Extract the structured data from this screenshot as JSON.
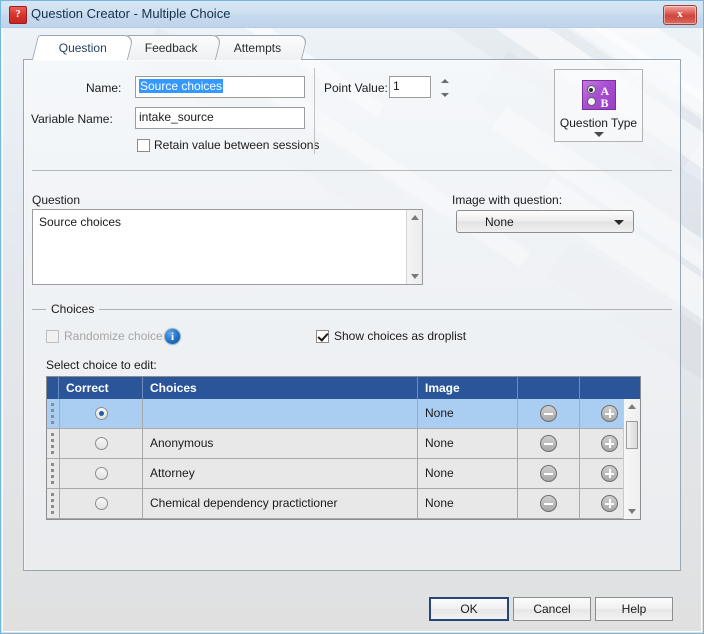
{
  "window": {
    "title": "Question Creator - Multiple Choice",
    "title_icon": "question-mark-icon",
    "close_label": "x"
  },
  "tabs": [
    {
      "label": "Question",
      "active": true
    },
    {
      "label": "Feedback",
      "active": false
    },
    {
      "label": "Attempts",
      "active": false
    }
  ],
  "form": {
    "name_label": "Name:",
    "name_value": "Source choices",
    "variable_label": "Variable Name:",
    "variable_value": "intake_source",
    "retain_label": "Retain value between sessions",
    "retain_checked": false,
    "point_value_label": "Point Value:",
    "point_value": "1"
  },
  "question_type": {
    "label": "Question Type",
    "icon": "multiple-choice-icon",
    "letter_a": "A",
    "letter_b": "B"
  },
  "question": {
    "label": "Question",
    "text": "Source choices",
    "image_label": "Image with question:",
    "image_value": "None"
  },
  "choices_group": {
    "title": "Choices",
    "randomize_label": "Randomize choices",
    "randomize_checked": false,
    "randomize_disabled": true,
    "info_icon": "info-icon",
    "info_glyph": "i",
    "droplist_label": "Show choices as droplist",
    "droplist_checked": true,
    "select_label": "Select choice to edit:"
  },
  "grid": {
    "columns": [
      "Correct",
      "Choices",
      "Image",
      "",
      ""
    ],
    "rows": [
      {
        "correct": true,
        "choice": "",
        "image": "None",
        "selected": true
      },
      {
        "correct": false,
        "choice": "Anonymous",
        "image": "None",
        "selected": false
      },
      {
        "correct": false,
        "choice": "Attorney",
        "image": "None",
        "selected": false
      },
      {
        "correct": false,
        "choice": "Chemical dependency practictioner",
        "image": "None",
        "selected": false
      }
    ]
  },
  "footer": {
    "ok": "OK",
    "cancel": "Cancel",
    "help": "Help"
  },
  "colors": {
    "title_bar": "#cfe0f0",
    "grid_header": "#2a5699",
    "row_selected": "#aacdf2",
    "selection": "#3399ff",
    "accent_purple": "#a84fd0",
    "close_red": "#cf443b"
  }
}
